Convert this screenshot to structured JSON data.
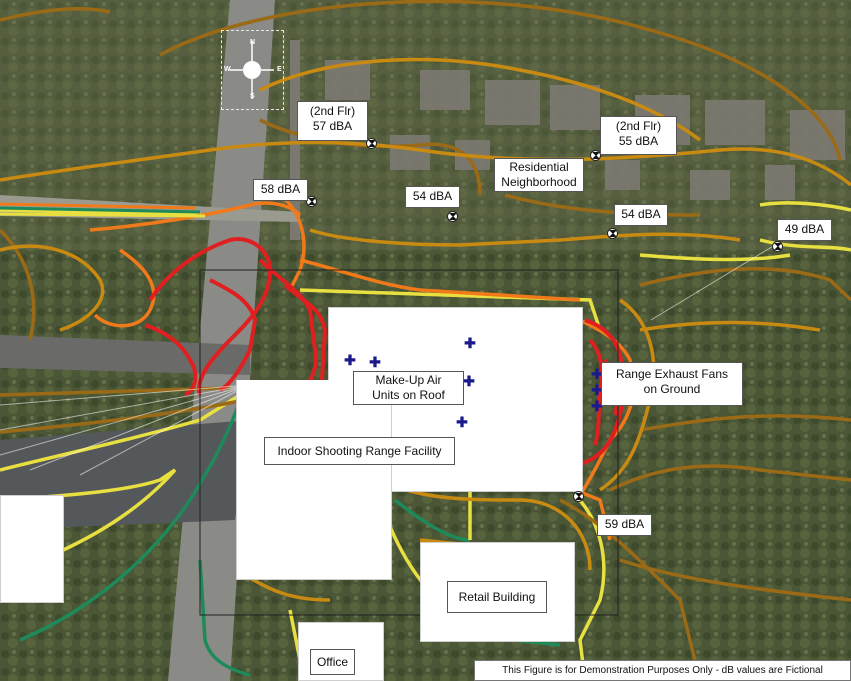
{
  "labels": {
    "receiver_2nd_57": [
      "(2nd Flr)",
      "57 dBA"
    ],
    "receiver_2nd_55": [
      "(2nd Flr)",
      "55 dBA"
    ],
    "receiver_58": "58 dBA",
    "receiver_54_a": "54 dBA",
    "receiver_54_b": "54 dBA",
    "receiver_49": "49 dBA",
    "receiver_59": "59 dBA",
    "residential": [
      "Residential",
      "Neighborhood"
    ],
    "makeup_air": [
      "Make-Up Air",
      "Units on Roof"
    ],
    "range_exhaust": [
      "Range Exhaust Fans",
      "on Ground"
    ],
    "facility": "Indoor Shooting Range Facility",
    "retail": "Retail Building",
    "office": "Office"
  },
  "compass": {
    "north": "N",
    "south": "S",
    "east": "E",
    "west": "W"
  },
  "disclaimer": "This Figure is for Demonstration Purposes Only - dB values are Fictional",
  "legend_colors": {
    "level_high": "#e02020",
    "level_mid_high": "#f07a1a",
    "level_mid": "#c98a12",
    "level_low_mid": "#9a6a16",
    "level_low": "#e8e040",
    "level_lowest": "#1e8a5a"
  },
  "icons": {
    "receiver": "receiver-marker-icon",
    "noise_source": "noise-source-cross-icon",
    "compass": "compass-rose-icon"
  }
}
